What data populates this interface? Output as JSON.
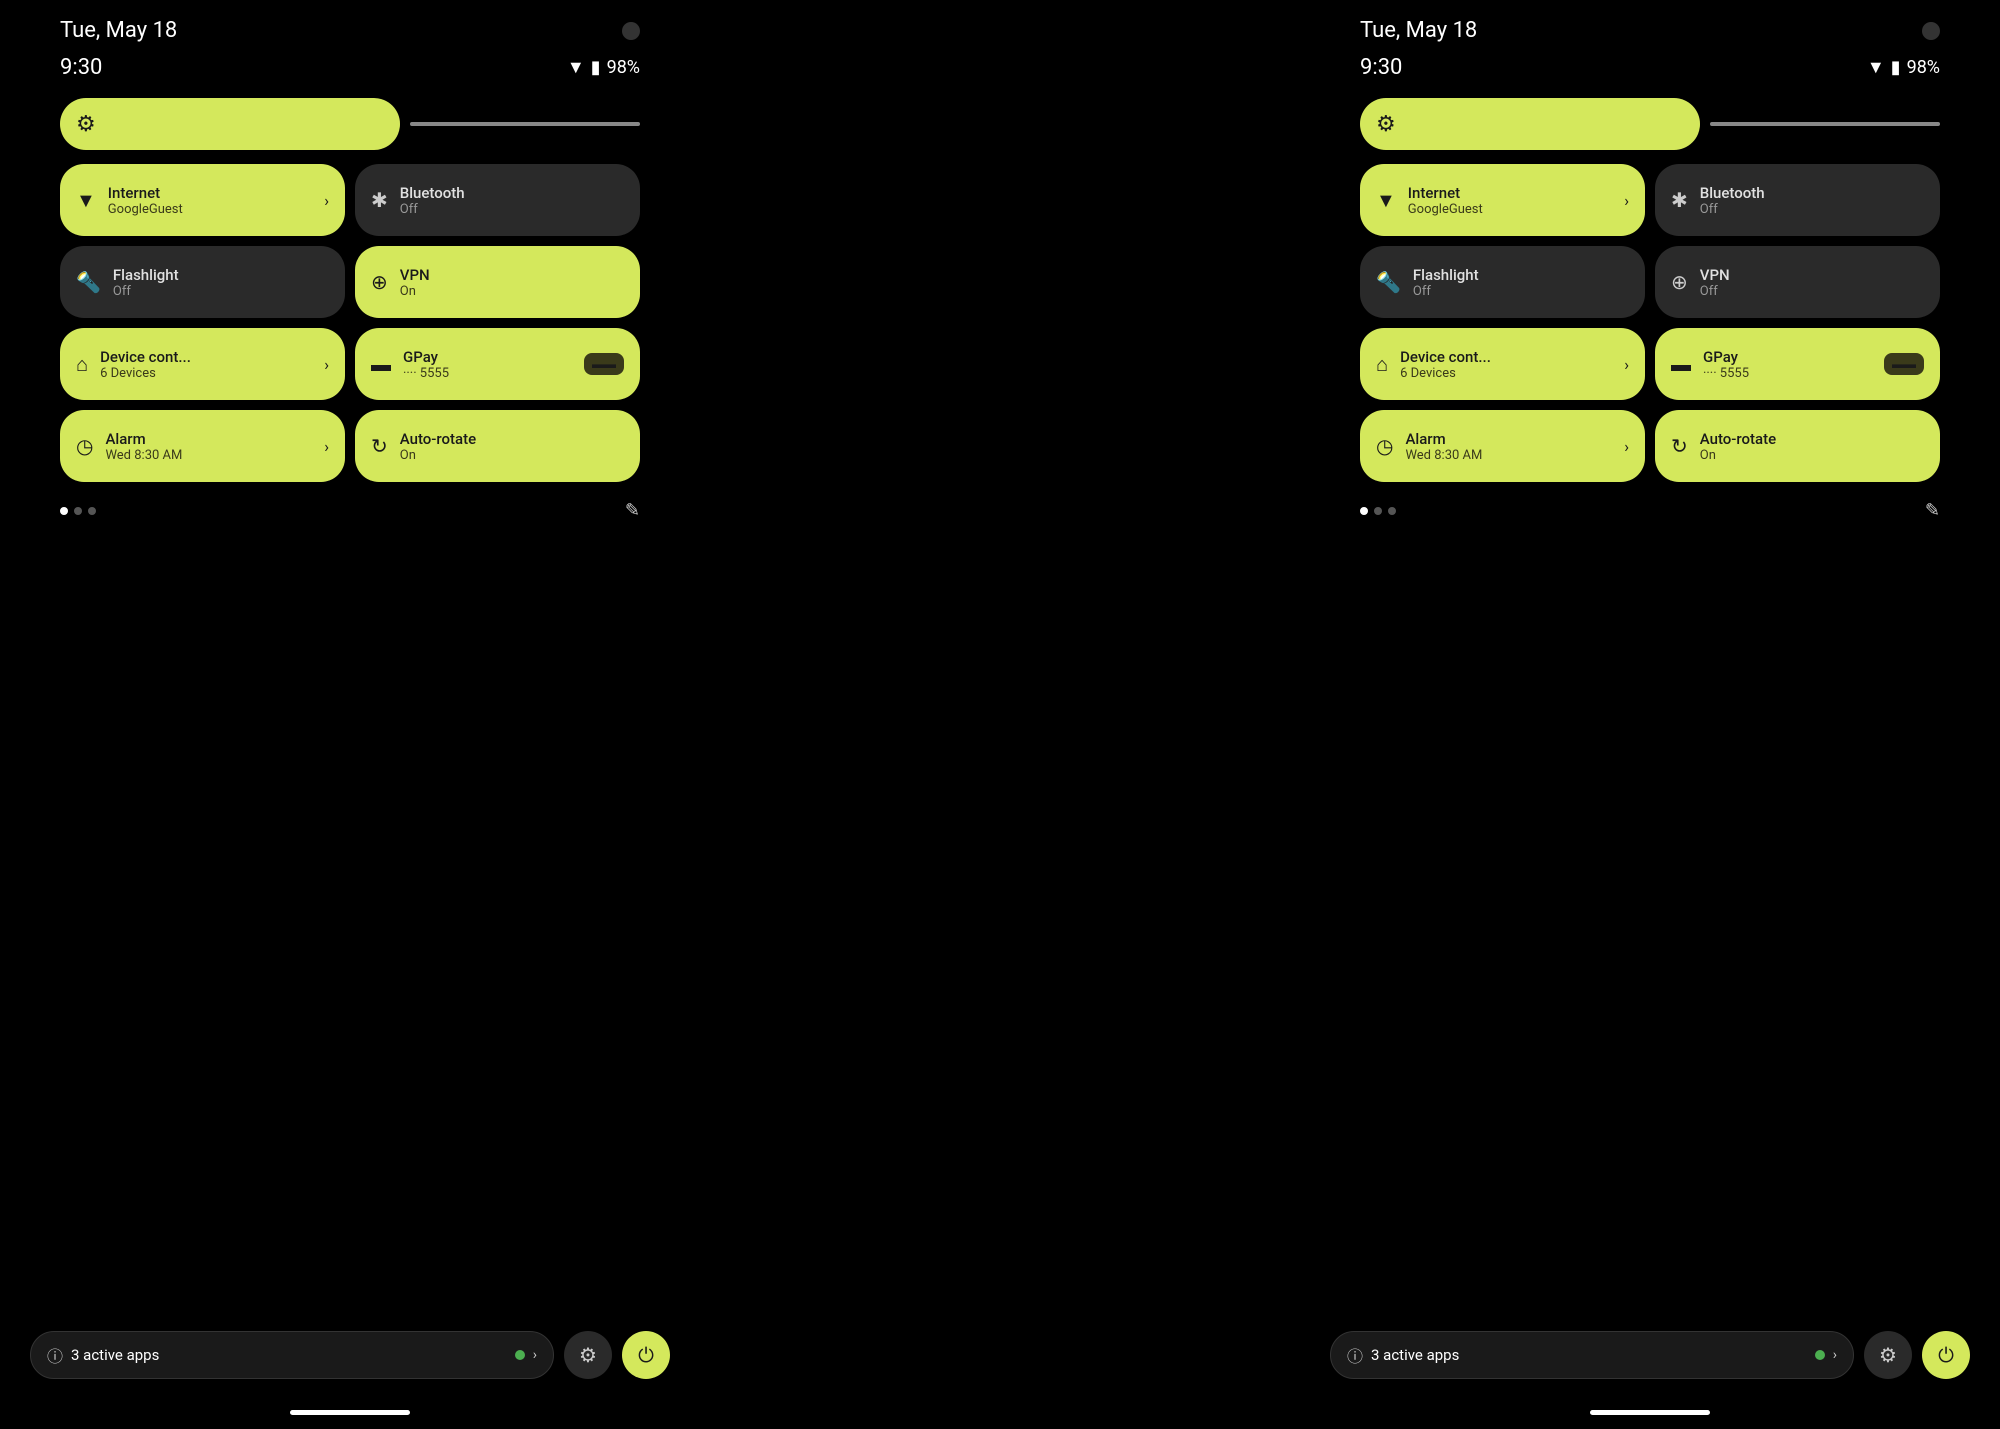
{
  "colors": {
    "active_tile": "#d4e85c",
    "inactive_tile": "#2a2a2a",
    "bg": "#000000",
    "active_text": "#1a1a1a",
    "inactive_text": "#e0e0e0"
  },
  "panels": [
    {
      "id": "left",
      "status": {
        "date": "Tue, May 18",
        "time": "9:30",
        "battery": "98%"
      },
      "brightness": {
        "icon": "⚙"
      },
      "tiles": [
        {
          "id": "internet",
          "active": true,
          "icon": "▼",
          "title": "Internet",
          "subtitle": "GoogleGuest",
          "hasChevron": true
        },
        {
          "id": "bluetooth",
          "active": false,
          "icon": "✱",
          "title": "Bluetooth",
          "subtitle": "Off",
          "hasChevron": false
        },
        {
          "id": "flashlight",
          "active": false,
          "icon": "🔦",
          "title": "Flashlight",
          "subtitle": "Off",
          "hasChevron": false
        },
        {
          "id": "vpn",
          "active": true,
          "icon": "⊕",
          "title": "VPN",
          "subtitle": "On",
          "hasChevron": false
        },
        {
          "id": "device-control",
          "active": true,
          "icon": "⌂",
          "title": "Device cont...",
          "subtitle": "6 Devices",
          "hasChevron": true
        },
        {
          "id": "gpay",
          "active": true,
          "icon": "▬",
          "title": "GPay",
          "subtitle": "···· 5555",
          "hasChevron": false,
          "hasCard": true
        },
        {
          "id": "alarm",
          "active": true,
          "icon": "◷",
          "title": "Alarm",
          "subtitle": "Wed 8:30 AM",
          "hasChevron": true
        },
        {
          "id": "auto-rotate",
          "active": true,
          "icon": "↻",
          "title": "Auto-rotate",
          "subtitle": "On",
          "hasChevron": false
        }
      ],
      "bottom": {
        "active_apps_label": "3 active apps",
        "settings_icon": "⚙",
        "power_icon": "⏻"
      }
    },
    {
      "id": "right",
      "status": {
        "date": "Tue, May 18",
        "time": "9:30",
        "battery": "98%"
      },
      "brightness": {
        "icon": "⚙"
      },
      "tiles": [
        {
          "id": "internet",
          "active": true,
          "icon": "▼",
          "title": "Internet",
          "subtitle": "GoogleGuest",
          "hasChevron": true
        },
        {
          "id": "bluetooth",
          "active": false,
          "icon": "✱",
          "title": "Bluetooth",
          "subtitle": "Off",
          "hasChevron": false
        },
        {
          "id": "flashlight",
          "active": false,
          "icon": "🔦",
          "title": "Flashlight",
          "subtitle": "Off",
          "hasChevron": false
        },
        {
          "id": "vpn",
          "active": false,
          "icon": "⊕",
          "title": "VPN",
          "subtitle": "Off",
          "hasChevron": false
        },
        {
          "id": "device-control",
          "active": true,
          "icon": "⌂",
          "title": "Device cont...",
          "subtitle": "6 Devices",
          "hasChevron": true
        },
        {
          "id": "gpay",
          "active": true,
          "icon": "▬",
          "title": "GPay",
          "subtitle": "···· 5555",
          "hasChevron": false,
          "hasCard": true
        },
        {
          "id": "alarm",
          "active": true,
          "icon": "◷",
          "title": "Alarm",
          "subtitle": "Wed 8:30 AM",
          "hasChevron": true
        },
        {
          "id": "auto-rotate",
          "active": true,
          "icon": "↻",
          "title": "Auto-rotate",
          "subtitle": "On",
          "hasChevron": false
        }
      ],
      "bottom": {
        "active_apps_label": "3 active apps",
        "settings_icon": "⚙",
        "power_icon": "⏻"
      }
    }
  ]
}
